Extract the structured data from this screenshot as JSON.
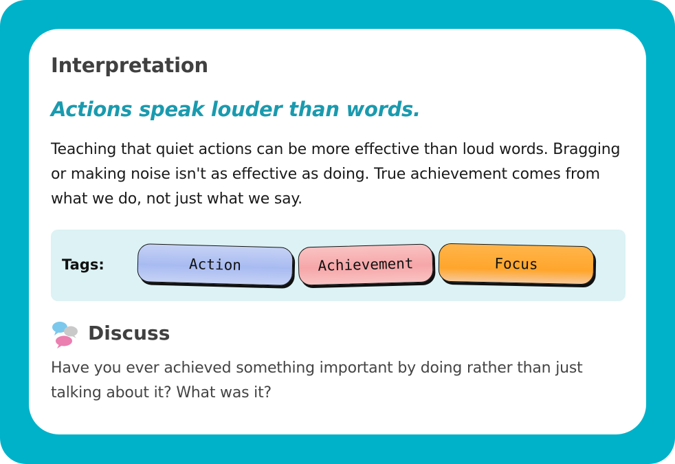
{
  "card": {
    "heading": "Interpretation",
    "proverb": "Actions speak louder than words.",
    "explanation": "Teaching that quiet actions can be more effective than loud words. Bragging or making noise isn't as effective as doing. True achievement comes from what we do, not just what we say."
  },
  "tags": {
    "label": "Tags:",
    "items": [
      {
        "label": "Action",
        "color": "#a8bbf1"
      },
      {
        "label": "Achievement",
        "color": "#f6a6a8"
      },
      {
        "label": "Focus",
        "color": "#ffa52c"
      }
    ]
  },
  "discuss": {
    "icon": "speech-bubbles-icon",
    "heading": "Discuss",
    "question": "Have you ever achieved something important by doing rather than just talking about it? What was it?"
  },
  "colors": {
    "frame": "#00b2c9",
    "accent": "#1a9aae",
    "tags_panel": "#dcf2f4"
  }
}
